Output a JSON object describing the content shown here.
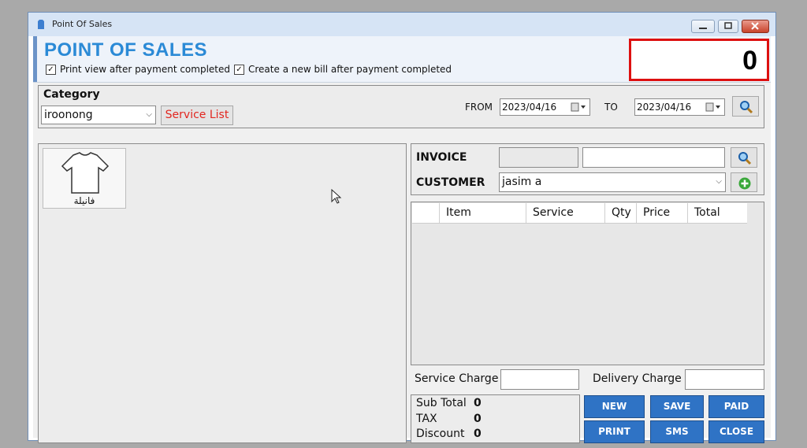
{
  "window": {
    "title": "Point Of Sales"
  },
  "header": {
    "title": "POINT OF SALES",
    "print_view_label": "Print view after payment completed",
    "new_bill_label": "Create a new bill after payment completed",
    "total_display": "0"
  },
  "category": {
    "label": "Category",
    "selected": "iroonong",
    "service_list_button": "Service List"
  },
  "date_range": {
    "from_label": "FROM",
    "from_value": "2023/04/16",
    "to_label": "TO",
    "to_value": "2023/04/16"
  },
  "products": [
    {
      "label": "فانيلة",
      "icon": "tshirt-icon"
    }
  ],
  "invoice": {
    "invoice_label": "INVOICE",
    "invoice_value": "",
    "invoice_search": "",
    "customer_label": "CUSTOMER",
    "customer_value": "jasim a"
  },
  "grid": {
    "columns": [
      "Item",
      "Service",
      "Qty",
      "Price",
      "Total"
    ]
  },
  "charges": {
    "service_charge_label": "Service Charge :",
    "service_charge_value": "",
    "delivery_charge_label": "Delivery Charge :",
    "delivery_charge_value": ""
  },
  "summary": {
    "sub_total_label": "Sub Total",
    "sub_total_value": "0",
    "tax_label": "TAX",
    "tax_value": "0",
    "discount_label": "Discount",
    "discount_value": "0"
  },
  "actions": {
    "new": "NEW",
    "save": "SAVE",
    "paid": "PAID",
    "print": "PRINT",
    "sms": "SMS",
    "close": "CLOSE"
  },
  "colors": {
    "accent": "#2b8ad6",
    "action_button": "#2f73c5",
    "highlight_border": "#dd1010",
    "service_list_text": "#e2261f"
  }
}
